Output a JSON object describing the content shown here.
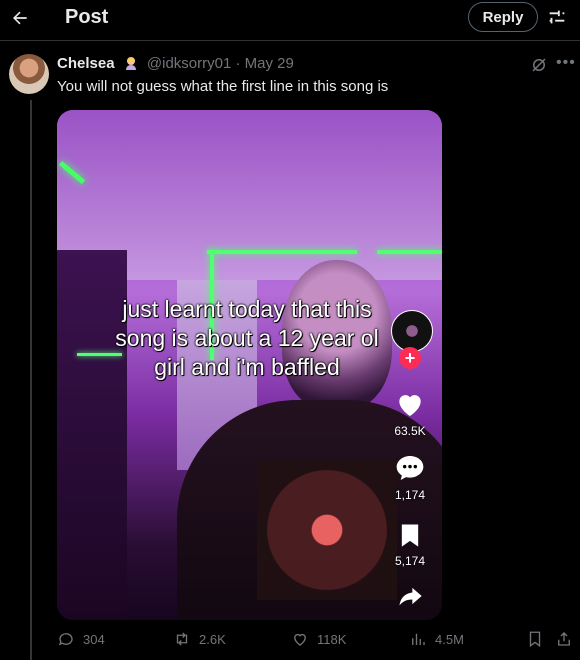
{
  "header": {
    "title": "Post",
    "reply_label": "Reply"
  },
  "tweet": {
    "display_name": "Chelsea",
    "handle": "@idksorry01",
    "separator": "·",
    "date": "May 29",
    "text": "You will not guess what the first line in this song is"
  },
  "video": {
    "caption_lines": [
      "just learnt today that this",
      "song is about a 12 year ol",
      "girl and i'm baffled"
    ],
    "likes": "63.5K",
    "comments": "1,174",
    "saves": "5,174",
    "follow_symbol": "+"
  },
  "actions": {
    "replies": "304",
    "reposts": "2.6K",
    "likes": "118K",
    "views": "4.5M"
  },
  "colors": {
    "background": "#000000",
    "text": "#e7e9ea",
    "muted": "#71767b",
    "border": "#2f3336",
    "neon": "#52ff70",
    "tiktok_red": "#fe2c55"
  }
}
